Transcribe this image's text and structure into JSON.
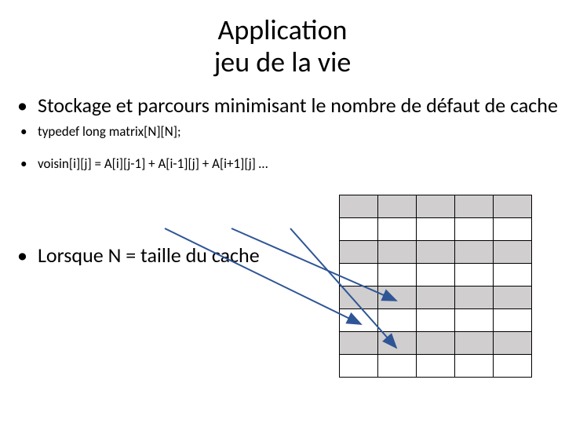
{
  "title_l1": "Application",
  "title_l2": "jeu de la vie",
  "bullets": {
    "b0": "Stockage et parcours minimisant le nombre de défaut de cache",
    "b1": "typedef long matrix[N][N];",
    "b2": "voisin[i][j] = A[i][j-1] + A[i-1][j] + A[i+1][j] …",
    "b3": "Lorsque N = taille du cache"
  }
}
